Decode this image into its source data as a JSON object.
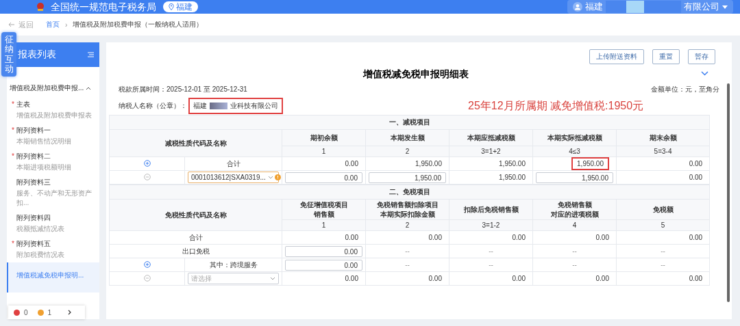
{
  "header": {
    "title": "全国统一规范电子税务局",
    "region": "福建",
    "user_prefix": "福建",
    "user_suffix": "有限公司"
  },
  "nav": {
    "back": "返回",
    "separator": "›",
    "breadcrumbs": [
      "首页",
      "增值税及附加税费申报（一般纳税人适用）"
    ]
  },
  "side_tab": "征纳互动",
  "sidebar": {
    "title": "报表列表",
    "required_mark": "*",
    "group": {
      "label": "增值税及附加税费申报...",
      "expanded": true
    },
    "items": [
      {
        "label": "主表",
        "sub": "增值税及附加税费申报表",
        "required": true,
        "selected": false
      },
      {
        "label": "附列资料一",
        "sub": "本期销售情况明细",
        "required": true,
        "selected": false
      },
      {
        "label": "附列资料二",
        "sub": "本期进项税额明细",
        "required": true,
        "selected": false
      },
      {
        "label": "附列资料三",
        "sub": "服务、不动产和无形资产扣...",
        "required": false,
        "selected": false
      },
      {
        "label": "附列资料四",
        "sub": "税额抵减情况表",
        "required": false,
        "selected": false
      },
      {
        "label": "附列资料五",
        "sub": "附加税费情况表",
        "required": true,
        "selected": false
      },
      {
        "label": "增值税减免税申报明...",
        "required": false,
        "selected": true
      }
    ],
    "status": {
      "errors": "0",
      "warnings": "1"
    }
  },
  "toolbar": {
    "buttons": [
      "上传附送资料",
      "重置",
      "暂存"
    ]
  },
  "form": {
    "title": "增值税减免税申报明细表",
    "period": "税款所属时间：2025-12-01 至 2025-12-31",
    "unit": "金额单位：元，至角分",
    "taxpayer_label": "纳税人名称（公章）：",
    "taxpayer_name_start": "福建",
    "taxpayer_name_end": "业科技有限公司",
    "taxpayer_highlighted": true,
    "annotation": "25年12月所属期 减免增值税:1950元"
  },
  "sections": [
    {
      "title": "一、减税项目",
      "name_header": "减税性质代码及名称",
      "columns": [
        {
          "label": [
            "期初余额"
          ],
          "index": "1"
        },
        {
          "label": [
            "本期发生额"
          ],
          "index": "2"
        },
        {
          "label": [
            "本期应抵减税额"
          ],
          "index": "3=1+2"
        },
        {
          "label": [
            "本期实际抵减税额"
          ],
          "index": "4≤3"
        },
        {
          "label": [
            "期末余额"
          ],
          "index": "5=3-4"
        }
      ],
      "rows": [
        {
          "kind": "sub",
          "label": "合计",
          "cells": [
            {
              "kind": "text",
              "value": "0.00"
            },
            {
              "kind": "text",
              "value": "1,950.00"
            },
            {
              "kind": "text",
              "value": "1,950.00"
            },
            {
              "kind": "highlight",
              "value": "1,950.00"
            },
            {
              "kind": "text",
              "value": "0.00"
            }
          ]
        },
        {
          "kind": "entry",
          "select": {
            "value": "0001013612|SXA0319...",
            "warning": true
          },
          "cells": [
            {
              "kind": "input",
              "value": "0.00"
            },
            {
              "kind": "input",
              "value": "1,950.00"
            },
            {
              "kind": "text",
              "value": "1,950.00"
            },
            {
              "kind": "input",
              "value": "1,950.00"
            },
            {
              "kind": "text",
              "value": "0.00"
            }
          ]
        }
      ]
    },
    {
      "title": "二、免税项目",
      "name_header": "免税性质代码及名称",
      "columns": [
        {
          "label": [
            "免征增值税项目",
            "销售额"
          ],
          "index": "1"
        },
        {
          "label": [
            "免税销售额扣除项目",
            "本期实际扣除金额"
          ],
          "index": "2"
        },
        {
          "label": [
            "扣除后免税销售额"
          ],
          "index": "3=1-2"
        },
        {
          "label": [
            "免税销售额",
            "对应的进项税额"
          ],
          "index": "4"
        },
        {
          "label": [
            "免税额"
          ],
          "index": "5"
        }
      ],
      "rows": [
        {
          "kind": "total",
          "label": "合计",
          "cells": [
            {
              "kind": "text",
              "value": "0.00"
            },
            {
              "kind": "text",
              "value": "0.00"
            },
            {
              "kind": "text",
              "value": "0.00"
            },
            {
              "kind": "text",
              "value": "0.00"
            },
            {
              "kind": "text",
              "value": "0.00"
            }
          ]
        },
        {
          "kind": "total",
          "label": "出口免税",
          "cells": [
            {
              "kind": "input",
              "value": "0.00"
            },
            {
              "kind": "dash",
              "value": "--"
            },
            {
              "kind": "dash",
              "value": "--"
            },
            {
              "kind": "dash",
              "value": "--"
            },
            {
              "kind": "dash",
              "value": "--"
            }
          ]
        },
        {
          "kind": "sub",
          "label": "其中：跨境服务",
          "cells": [
            {
              "kind": "input",
              "value": "0.00"
            },
            {
              "kind": "dash",
              "value": "--"
            },
            {
              "kind": "dash",
              "value": "--"
            },
            {
              "kind": "dash",
              "value": "--"
            },
            {
              "kind": "dash",
              "value": "--"
            }
          ]
        },
        {
          "kind": "entry",
          "select": {
            "placeholder": "请选择",
            "warning": false
          },
          "cells": [
            {
              "kind": "text",
              "value": "0.00"
            },
            {
              "kind": "text",
              "value": "0.00"
            },
            {
              "kind": "text",
              "value": "0.00"
            },
            {
              "kind": "text",
              "value": "0.00"
            },
            {
              "kind": "text",
              "value": "0.00"
            }
          ]
        }
      ]
    }
  ]
}
